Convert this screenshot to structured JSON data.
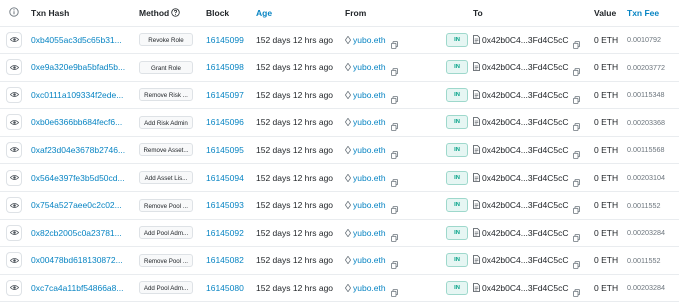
{
  "headers": {
    "txn_hash": "Txn Hash",
    "method": "Method",
    "block": "Block",
    "age": "Age",
    "from": "From",
    "to": "To",
    "value": "Value",
    "txn_fee": "Txn Fee"
  },
  "rows": [
    {
      "hash": "0xb4055ac3d5c65b31...",
      "method": "Revoke Role",
      "block": "16145099",
      "age": "152 days 12 hrs ago",
      "from": "yubo.eth",
      "direction": "IN",
      "to": "0x42b0C4...3Fd4C5cC",
      "value": "0 ETH",
      "fee": "0.0010792"
    },
    {
      "hash": "0xe9a320e9ba5bfad5b...",
      "method": "Grant Role",
      "block": "16145098",
      "age": "152 days 12 hrs ago",
      "from": "yubo.eth",
      "direction": "IN",
      "to": "0x42b0C4...3Fd4C5cC",
      "value": "0 ETH",
      "fee": "0.00203772"
    },
    {
      "hash": "0xc0111a109334f2ede...",
      "method": "Remove Risk ...",
      "block": "16145097",
      "age": "152 days 12 hrs ago",
      "from": "yubo.eth",
      "direction": "IN",
      "to": "0x42b0C4...3Fd4C5cC",
      "value": "0 ETH",
      "fee": "0.00115348"
    },
    {
      "hash": "0xb0e6366bb684fecf6...",
      "method": "Add Risk Admin",
      "block": "16145096",
      "age": "152 days 12 hrs ago",
      "from": "yubo.eth",
      "direction": "IN",
      "to": "0x42b0C4...3Fd4C5cC",
      "value": "0 ETH",
      "fee": "0.00203368"
    },
    {
      "hash": "0xaf23d04e3678b2746...",
      "method": "Remove Asset...",
      "block": "16145095",
      "age": "152 days 12 hrs ago",
      "from": "yubo.eth",
      "direction": "IN",
      "to": "0x42b0C4...3Fd4C5cC",
      "value": "0 ETH",
      "fee": "0.00115568"
    },
    {
      "hash": "0x564e397fe3b5d50cd...",
      "method": "Add Asset Lis...",
      "block": "16145094",
      "age": "152 days 12 hrs ago",
      "from": "yubo.eth",
      "direction": "IN",
      "to": "0x42b0C4...3Fd4C5cC",
      "value": "0 ETH",
      "fee": "0.00203104"
    },
    {
      "hash": "0x754a527aee0c2c02...",
      "method": "Remove Pool ...",
      "block": "16145093",
      "age": "152 days 12 hrs ago",
      "from": "yubo.eth",
      "direction": "IN",
      "to": "0x42b0C4...3Fd4C5cC",
      "value": "0 ETH",
      "fee": "0.0011552"
    },
    {
      "hash": "0x82cb2005c0a23781...",
      "method": "Add Pool Adm...",
      "block": "16145092",
      "age": "152 days 12 hrs ago",
      "from": "yubo.eth",
      "direction": "IN",
      "to": "0x42b0C4...3Fd4C5cC",
      "value": "0 ETH",
      "fee": "0.00203284"
    },
    {
      "hash": "0x00478bd618130872...",
      "method": "Remove Pool ...",
      "block": "16145082",
      "age": "152 days 12 hrs ago",
      "from": "yubo.eth",
      "direction": "IN",
      "to": "0x42b0C4...3Fd4C5cC",
      "value": "0 ETH",
      "fee": "0.0011552"
    },
    {
      "hash": "0xc7ca4a11bf54866a8...",
      "method": "Add Pool Adm...",
      "block": "16145080",
      "age": "152 days 12 hrs ago",
      "from": "yubo.eth",
      "direction": "IN",
      "to": "0x42b0C4...3Fd4C5cC",
      "value": "0 ETH",
      "fee": "0.00203284"
    }
  ],
  "icons": {
    "header_info": "info-icon",
    "method_help": "question-circle-icon",
    "row_preview": "eye-icon",
    "from_type": "ens-name-icon",
    "copy": "copy-icon",
    "to_type": "contract-file-icon"
  },
  "colors": {
    "link": "#0784c3",
    "in_badge_text": "#00a186",
    "in_badge_bg": "#e6f6f3",
    "border": "#e9ecef"
  }
}
